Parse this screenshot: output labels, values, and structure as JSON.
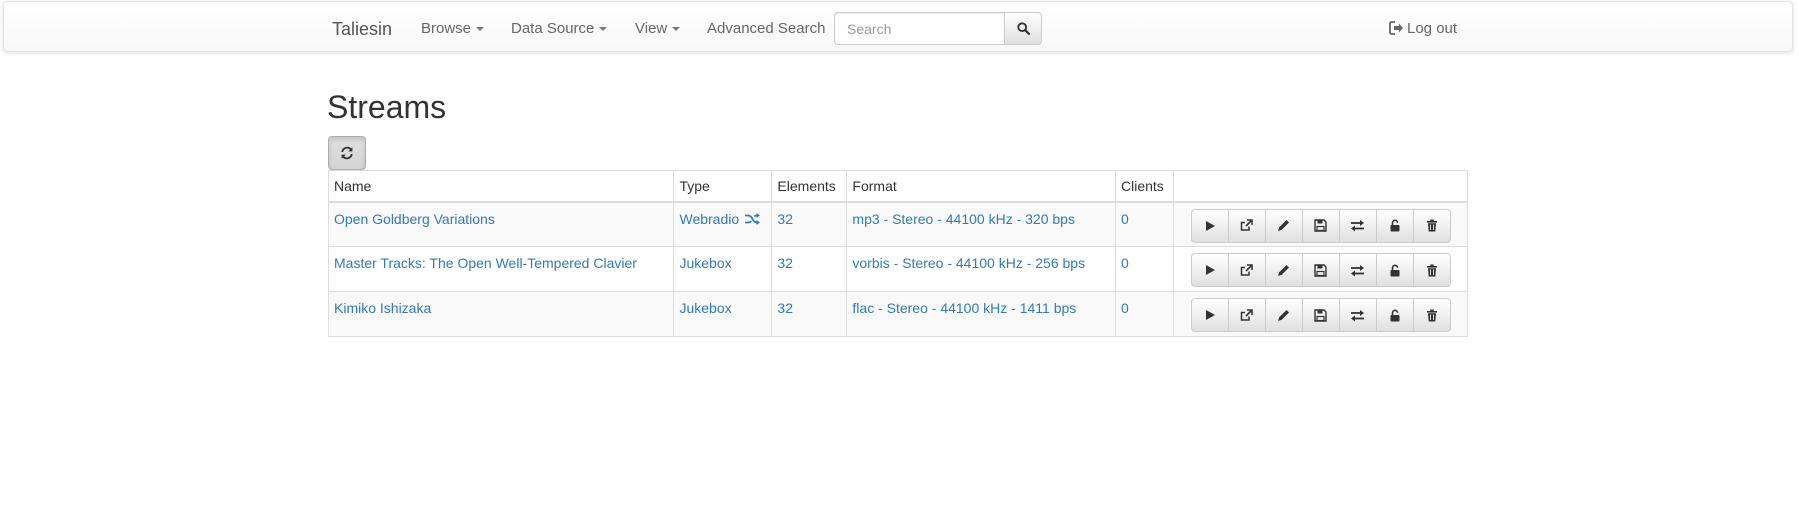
{
  "navbar": {
    "brand": "Taliesin",
    "items": [
      {
        "label": "Browse",
        "dropdown": true
      },
      {
        "label": "Data Source",
        "dropdown": true
      },
      {
        "label": "View",
        "dropdown": true
      },
      {
        "label": "Advanced Search",
        "dropdown": false
      }
    ],
    "search_placeholder": "Search",
    "search_value": "",
    "logout_label": "Log out"
  },
  "page": {
    "title": "Streams"
  },
  "table": {
    "columns": [
      "Name",
      "Type",
      "Elements",
      "Format",
      "Clients"
    ],
    "rows": [
      {
        "name": "Open Goldberg Variations",
        "type": "Webradio",
        "type_icon": "random-icon",
        "elements": "32",
        "format": "mp3 - Stereo - 44100 kHz - 320 bps",
        "clients": "0"
      },
      {
        "name": "Master Tracks: The Open Well-Tempered Clavier",
        "type": "Jukebox",
        "type_icon": "",
        "elements": "32",
        "format": "vorbis - Stereo - 44100 kHz - 256 bps",
        "clients": "0"
      },
      {
        "name": "Kimiko Ishizaka",
        "type": "Jukebox",
        "type_icon": "",
        "elements": "32",
        "format": "flac - Stereo - 44100 kHz - 1411 bps",
        "clients": "0"
      }
    ],
    "row_actions": [
      "play-icon",
      "external-link-icon",
      "pencil-icon",
      "save-icon",
      "transfer-icon",
      "unlock-icon",
      "trash-icon"
    ]
  },
  "colors": {
    "link": "#337ab7",
    "text": "#333333",
    "navbar_text": "#666666",
    "border": "#dddddd",
    "stripe": "#f9f9f9"
  }
}
